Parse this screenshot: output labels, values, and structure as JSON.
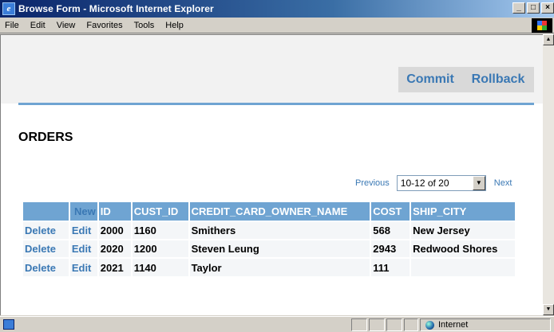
{
  "window": {
    "title": "Browse Form - Microsoft Internet Explorer",
    "controls": {
      "minimize": "_",
      "maximize": "□",
      "close": "×"
    }
  },
  "menu": [
    "File",
    "Edit",
    "View",
    "Favorites",
    "Tools",
    "Help"
  ],
  "page": {
    "buttons": {
      "commit": "Commit",
      "rollback": "Rollback"
    },
    "section_title": "ORDERS",
    "pager": {
      "previous": "Previous",
      "range": "10-12 of 20",
      "next": "Next"
    },
    "table": {
      "headers": [
        "",
        "New",
        "ID",
        "CUST_ID",
        "CREDIT_CARD_OWNER_NAME",
        "COST",
        "SHIP_CITY"
      ],
      "rows": [
        {
          "delete": "Delete",
          "edit": "Edit",
          "id": "2000",
          "cust_id": "1160",
          "owner": "Smithers",
          "cost": "568",
          "city": "New Jersey"
        },
        {
          "delete": "Delete",
          "edit": "Edit",
          "id": "2020",
          "cust_id": "1200",
          "owner": "Steven Leung",
          "cost": "2943",
          "city": "Redwood Shores"
        },
        {
          "delete": "Delete",
          "edit": "Edit",
          "id": "2021",
          "cust_id": "1140",
          "owner": "Taylor",
          "cost": "111",
          "city": ""
        }
      ]
    }
  },
  "status": {
    "zone": "Internet"
  },
  "colors": {
    "accent": "#6fa4d2",
    "link": "#3a78b4",
    "title_bar": "#0a246a"
  }
}
